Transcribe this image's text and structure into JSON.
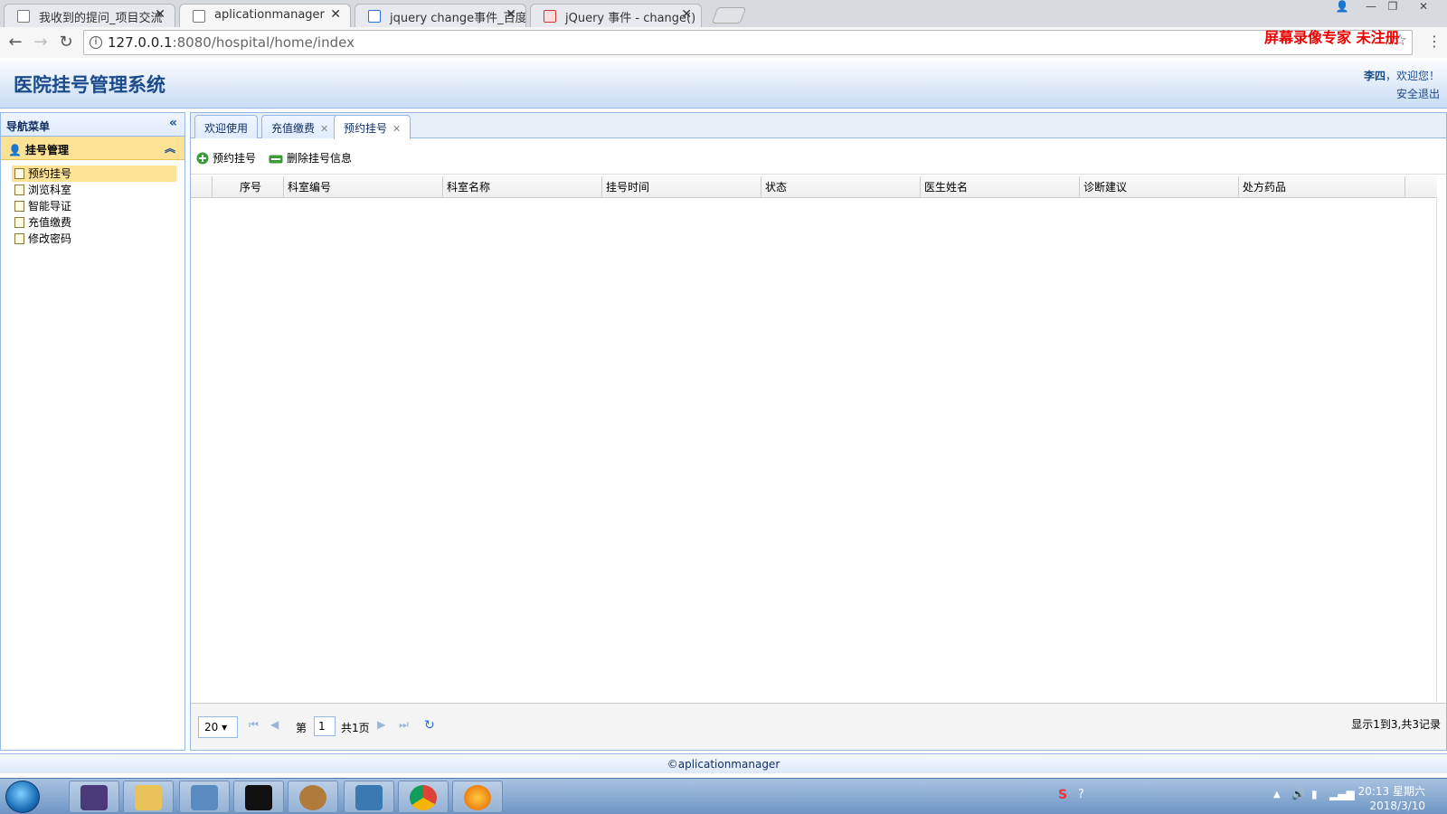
{
  "browser": {
    "tabs": [
      {
        "title": "我收到的提问_项目交流"
      },
      {
        "title": "aplicationmanager"
      },
      {
        "title": "jquery change事件_百度"
      },
      {
        "title": "jQuery 事件 - change()"
      }
    ],
    "url_host": "127.0.0.1",
    "url_path": ":8080/hospital/home/index"
  },
  "watermark": "屏幕录像专家  未注册",
  "header": {
    "title": "医院挂号管理系统",
    "user": "李四",
    "welcome": "，欢迎您！",
    "logout": "安全退出"
  },
  "sidebar": {
    "title": "导航菜单",
    "group": "挂号管理",
    "items": [
      "预约挂号",
      "浏览科室",
      "智能导证",
      "充值缴费",
      "修改密码"
    ]
  },
  "tabs": [
    "欢迎使用",
    "充值缴费",
    "预约挂号"
  ],
  "toolbar": {
    "add": "预约挂号",
    "delete": "删除挂号信息"
  },
  "grid": {
    "columns": [
      "序号",
      "科室编号",
      "科室名称",
      "挂号时间",
      "状态",
      "医生姓名",
      "诊断建议",
      "处方药品"
    ]
  },
  "pager": {
    "page_size": "20",
    "page_prefix": "第",
    "page_value": "1",
    "page_total": "共1页",
    "summary": "显示1到3,共3记录"
  },
  "footer": "©aplicationmanager",
  "clock": {
    "time": "20:13 星期六",
    "date": "2018/3/10"
  }
}
